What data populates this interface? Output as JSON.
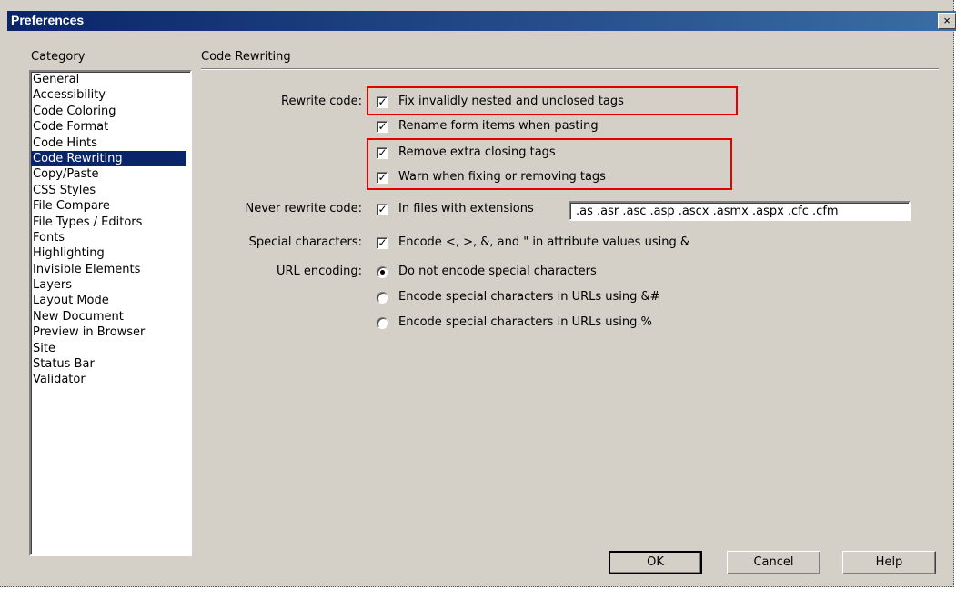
{
  "window": {
    "title": "Preferences",
    "close_glyph": "×"
  },
  "category": {
    "header": "Category",
    "items": [
      "General",
      "Accessibility",
      "Code Coloring",
      "Code Format",
      "Code Hints",
      "Code Rewriting",
      "Copy/Paste",
      "CSS Styles",
      "File Compare",
      "File Types / Editors",
      "Fonts",
      "Highlighting",
      "Invisible Elements",
      "Layers",
      "Layout Mode",
      "New Document",
      "Preview in Browser",
      "Site",
      "Status Bar",
      "Validator"
    ],
    "selected": "Code Rewriting"
  },
  "section": {
    "title": "Code Rewriting"
  },
  "rewrite": {
    "label": "Rewrite code:",
    "options": [
      {
        "label": "Fix invalidly nested and unclosed tags",
        "checked": true
      },
      {
        "label": "Rename form items when pasting",
        "checked": true
      },
      {
        "label": "Remove extra closing tags",
        "checked": true
      },
      {
        "label": "Warn when fixing or removing tags",
        "checked": true
      }
    ]
  },
  "never_rewrite": {
    "label": "Never rewrite code:",
    "option_label": "In files with extensions",
    "checked": true,
    "extensions_value": ".as .asr .asc .asp .ascx .asmx .aspx .cfc .cfm"
  },
  "special_chars": {
    "label": "Special characters:",
    "option_label": "Encode <, >, &, and \" in attribute values using &",
    "checked": true
  },
  "url_encoding": {
    "label": "URL encoding:",
    "options": [
      {
        "label": "Do not encode special characters",
        "selected": true
      },
      {
        "label": "Encode special characters in URLs using &#",
        "selected": false
      },
      {
        "label": "Encode special characters in URLs using %",
        "selected": false
      }
    ]
  },
  "buttons": {
    "ok": "OK",
    "cancel": "Cancel",
    "help": "Help"
  },
  "colors": {
    "highlight": "#e00000",
    "selection": "#0a246a",
    "dialog_bg": "#d4d0c8"
  }
}
